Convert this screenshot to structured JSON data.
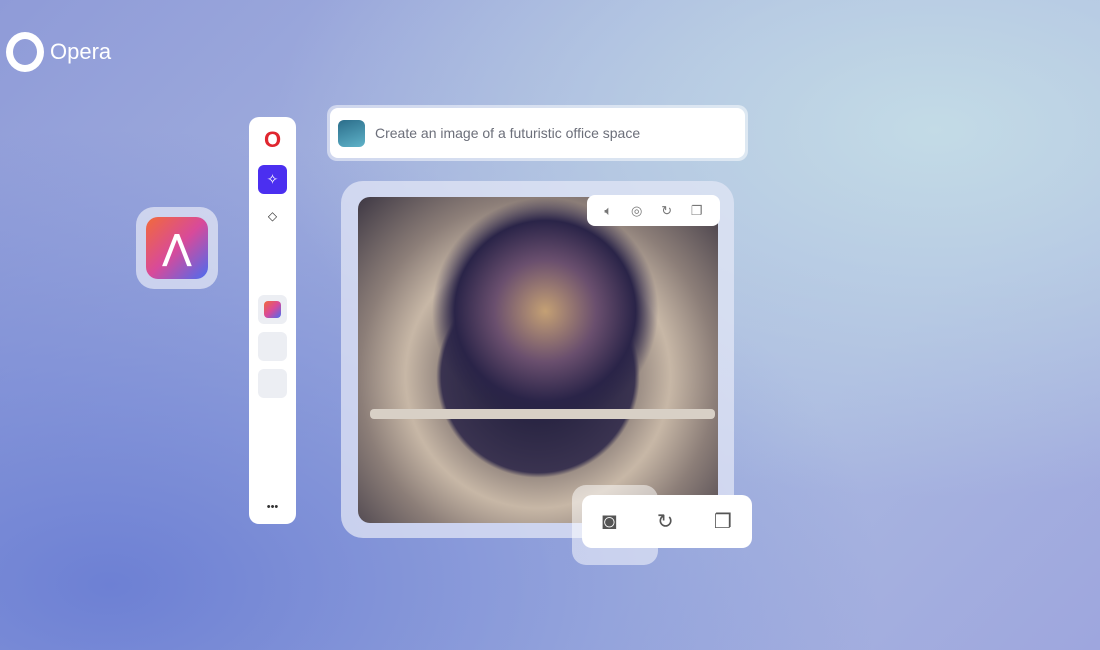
{
  "brand": {
    "name": "Opera"
  },
  "prompt": {
    "text": "Create an image of a futuristic office space"
  },
  "sidebar": {
    "items": [
      {
        "icon": "opera-icon"
      },
      {
        "icon": "sparkle-icon",
        "active": true
      },
      {
        "icon": "diamond-icon"
      },
      {
        "icon": "aria-app-icon"
      },
      {
        "icon": "empty-slot"
      },
      {
        "icon": "empty-slot"
      }
    ],
    "more": "•••"
  },
  "colors": {
    "accent": "#4b2ff0",
    "opera_red": "#e0262f"
  },
  "image_toolbar": [
    "speaker-icon",
    "camera-icon",
    "refresh-icon",
    "copy-icon"
  ],
  "large_toolbar": [
    "camera-icon",
    "refresh-icon",
    "copy-icon"
  ]
}
